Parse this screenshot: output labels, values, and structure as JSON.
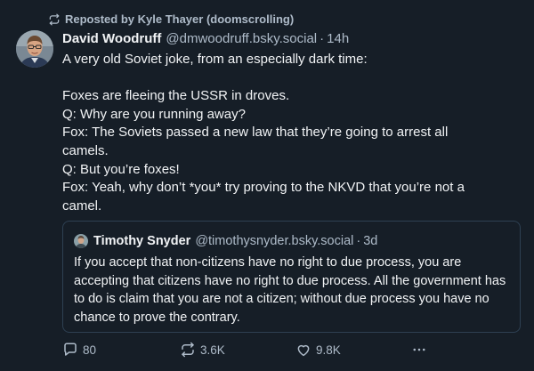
{
  "repost": {
    "label": "Reposted by Kyle Thayer (doomscrolling)"
  },
  "post": {
    "author_name": "David Woodruff",
    "author_handle": "@dmwoodruff.bsky.social",
    "separator": "·",
    "timestamp": "14h",
    "text": "A very old Soviet joke, from an especially dark time:\n\nFoxes are fleeing the USSR in droves.\nQ: Why are you running away?\nFox: The Soviets passed a new law that they’re going to arrest all\ncamels.\nQ: But you’re foxes!\nFox: Yeah, why don’t *you* try proving to the NKVD that you’re not a\ncamel."
  },
  "quote": {
    "author_name": "Timothy Snyder",
    "author_handle": "@timothysnyder.bsky.social",
    "separator": "·",
    "timestamp": "3d",
    "text": "If you accept that non-citizens have no right to due process, you are accepting that citizens have no right to due process. All the government has to do is claim that you are not a citizen; without due process you have no chance to prove the contrary."
  },
  "actions": {
    "reply_count": "80",
    "repost_count": "3.6K",
    "like_count": "9.8K",
    "icons": [
      "reply-icon",
      "repost-icon",
      "like-icon",
      "more-icon"
    ]
  },
  "colors": {
    "background": "#161e27",
    "text": "#f1f3f5",
    "secondary_text": "#aebbc9",
    "border": "#2e4052"
  }
}
